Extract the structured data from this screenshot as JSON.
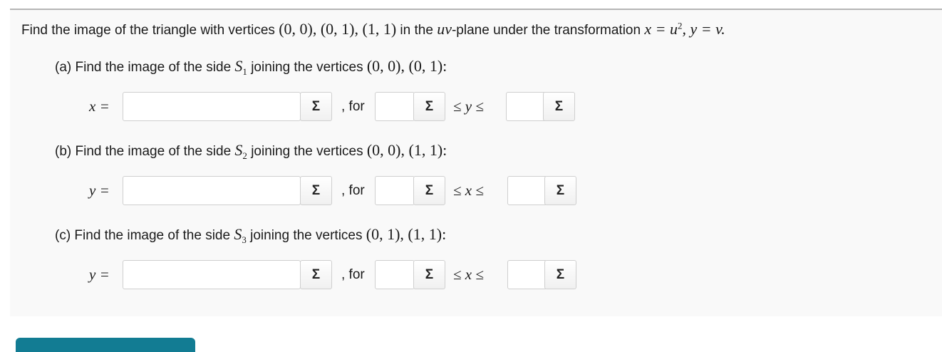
{
  "question": {
    "text_before": "Find the image of the triangle with vertices ",
    "vertices": "(0, 0), (0, 1), (1, 1)",
    "text_mid": " in the ",
    "plane": "uv",
    "text_after": "-plane under the transformation ",
    "transform_x": "x = u",
    "transform_x_exp": "2",
    "transform_y": ", y = v."
  },
  "parts": [
    {
      "prefix": "(a) Find the image of the side ",
      "side": "S",
      "side_sub": "1",
      "joining": " joining the vertices ",
      "vertices": "(0, 0), (0, 1):",
      "lhs": "x =",
      "for_label": ", for",
      "ineq": "≤ y ≤",
      "expr_value": "",
      "lower_value": "",
      "upper_value": ""
    },
    {
      "prefix": "(b) Find the image of the side ",
      "side": "S",
      "side_sub": "2",
      "joining": " joining the vertices ",
      "vertices": "(0, 0), (1, 1):",
      "lhs": "y =",
      "for_label": ", for",
      "ineq": "≤ x ≤",
      "expr_value": "",
      "lower_value": "",
      "upper_value": ""
    },
    {
      "prefix": "(c) Find the image of the side ",
      "side": "S",
      "side_sub": "3",
      "joining": " joining the vertices ",
      "vertices": "(0, 1), (1, 1):",
      "lhs": "y =",
      "for_label": ", for",
      "ineq": "≤ x ≤",
      "expr_value": "",
      "lower_value": "",
      "upper_value": ""
    }
  ],
  "sigma_label": "Σ",
  "icons": {
    "sigma": "sigma-icon"
  },
  "colors": {
    "submit": "#127c93",
    "border": "#cfcfcf",
    "panel": "#f9f9f9"
  }
}
